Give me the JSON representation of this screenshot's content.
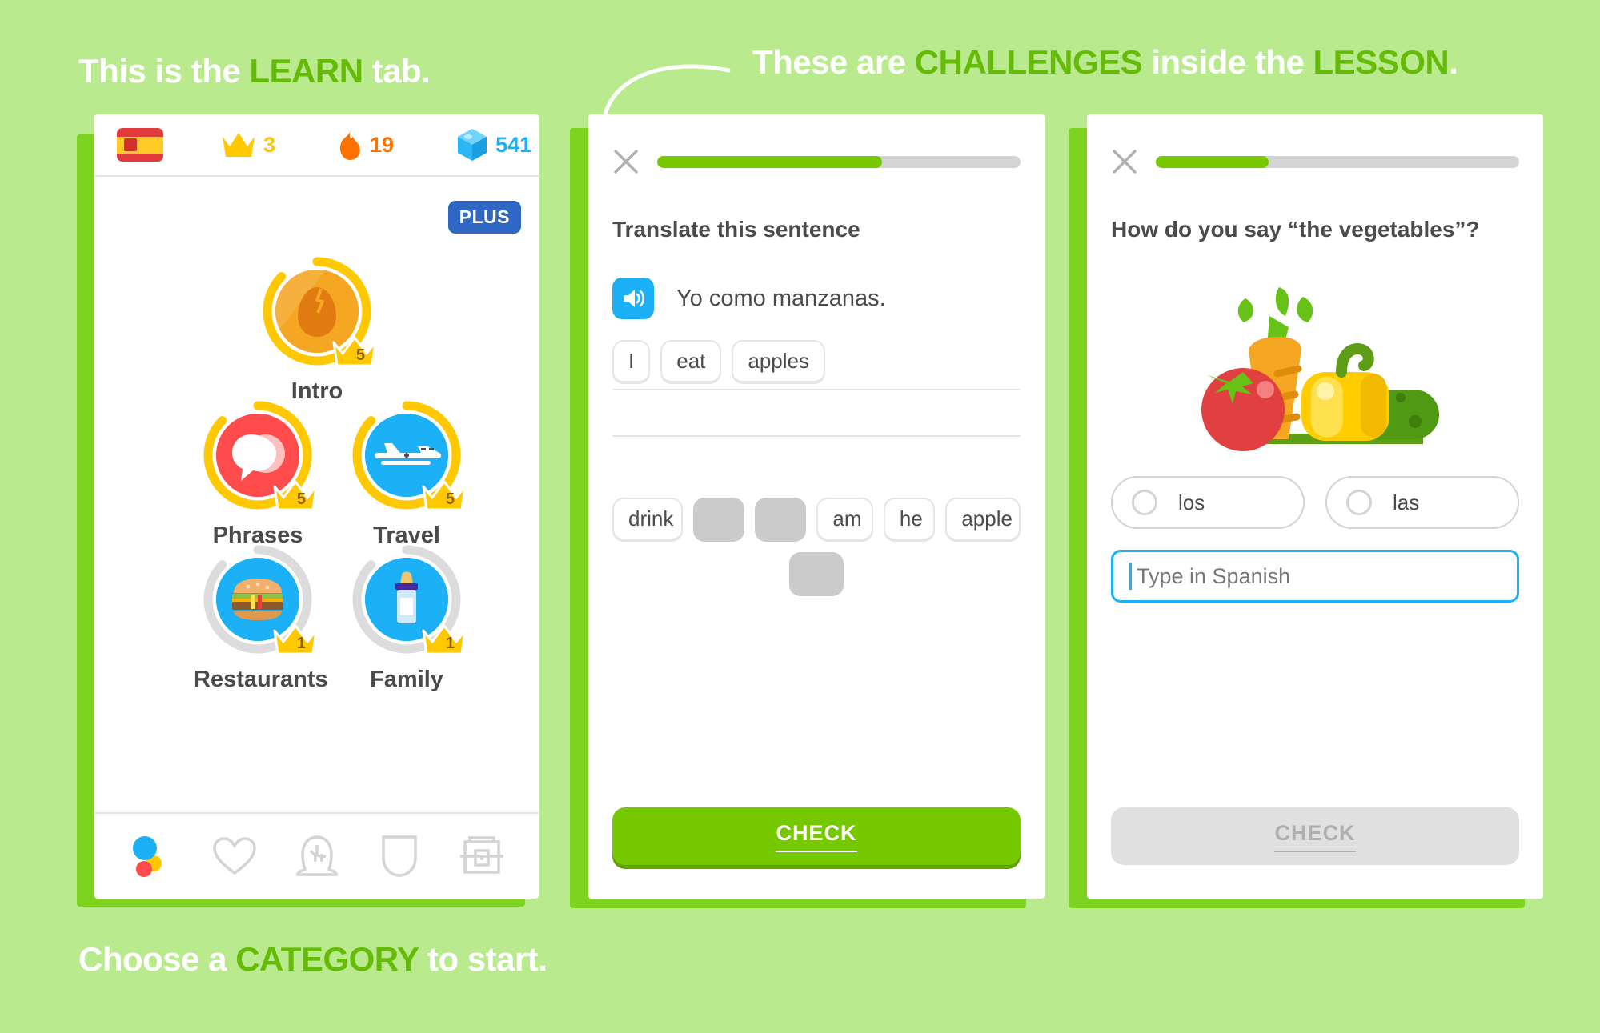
{
  "annotations": {
    "learn_tab": {
      "pre": "This is the ",
      "hl": "LEARN",
      "post": " tab."
    },
    "challenges": {
      "pre": "These are ",
      "hl": "CHALLENGES",
      "mid": " inside the ",
      "hl2": "LESSON",
      "post": "."
    },
    "category": {
      "pre": "Choose a ",
      "hl": "CATEGORY",
      "post": " to start."
    }
  },
  "colors": {
    "background": "#b9eb8e",
    "accent_green": "#66bb08",
    "duo_green": "#78c800",
    "blue": "#1cb0f6",
    "gold": "#ffc800",
    "red": "#ff4b4b",
    "orange": "#ff7200",
    "plus_blue": "#3067c4"
  },
  "learn_tab": {
    "header": {
      "flag_icon": "spanish-flag-icon",
      "crown_icon": "crown-icon",
      "crown_value": "3",
      "streak_icon": "flame-icon",
      "streak_value": "19",
      "gem_icon": "gem-icon",
      "gem_value": "541"
    },
    "plus_badge": "PLUS",
    "skills": [
      {
        "label": "Intro",
        "icon": "egg-icon",
        "crown_level": "5",
        "ring": "gold",
        "circle_color": "#f2a23c"
      },
      {
        "label": "Phrases",
        "icon": "speech-bubble-icon",
        "crown_level": "5",
        "ring": "gold",
        "circle_color": "#ff4b4b"
      },
      {
        "label": "Travel",
        "icon": "airplane-icon",
        "crown_level": "5",
        "ring": "gold",
        "circle_color": "#1cb0f6"
      },
      {
        "label": "Restaurants",
        "icon": "hamburger-icon",
        "crown_level": "1",
        "ring": "gray",
        "circle_color": "#1cb0f6"
      },
      {
        "label": "Family",
        "icon": "baby-bottle-icon",
        "crown_level": "1",
        "ring": "gray",
        "circle_color": "#1cb0f6"
      }
    ],
    "nav_items": [
      {
        "name": "learn",
        "icon": "duo-dots-icon"
      },
      {
        "name": "health",
        "icon": "heart-icon"
      },
      {
        "name": "profile",
        "icon": "person-icon"
      },
      {
        "name": "shield",
        "icon": "shield-icon"
      },
      {
        "name": "chest",
        "icon": "treasure-chest-icon"
      }
    ]
  },
  "challenge_translate": {
    "close_icon": "close-icon",
    "progress_percent": 62,
    "prompt": "Translate this sentence",
    "speaker_icon": "speaker-icon",
    "sentence": "Yo como manzanas.",
    "answer_tiles": [
      "I",
      "eat",
      "apples"
    ],
    "word_bank_row1": [
      {
        "label": "drink",
        "used": false
      },
      {
        "label": "",
        "used": true
      },
      {
        "label": "",
        "used": true
      },
      {
        "label": "am",
        "used": false
      },
      {
        "label": "he",
        "used": false
      },
      {
        "label": "apple",
        "used": false
      }
    ],
    "word_bank_row2": [
      {
        "label": "",
        "used": true
      }
    ],
    "check_label": "CHECK",
    "check_enabled": true
  },
  "challenge_vegetables": {
    "close_icon": "close-icon",
    "progress_percent": 31,
    "prompt": "How do you say “the vegetables”?",
    "illustration": "vegetables-illustration",
    "choices": [
      {
        "label": "los",
        "selected": false
      },
      {
        "label": "las",
        "selected": false
      }
    ],
    "input_placeholder": "Type in Spanish",
    "input_value": "",
    "check_label": "CHECK",
    "check_enabled": false
  }
}
